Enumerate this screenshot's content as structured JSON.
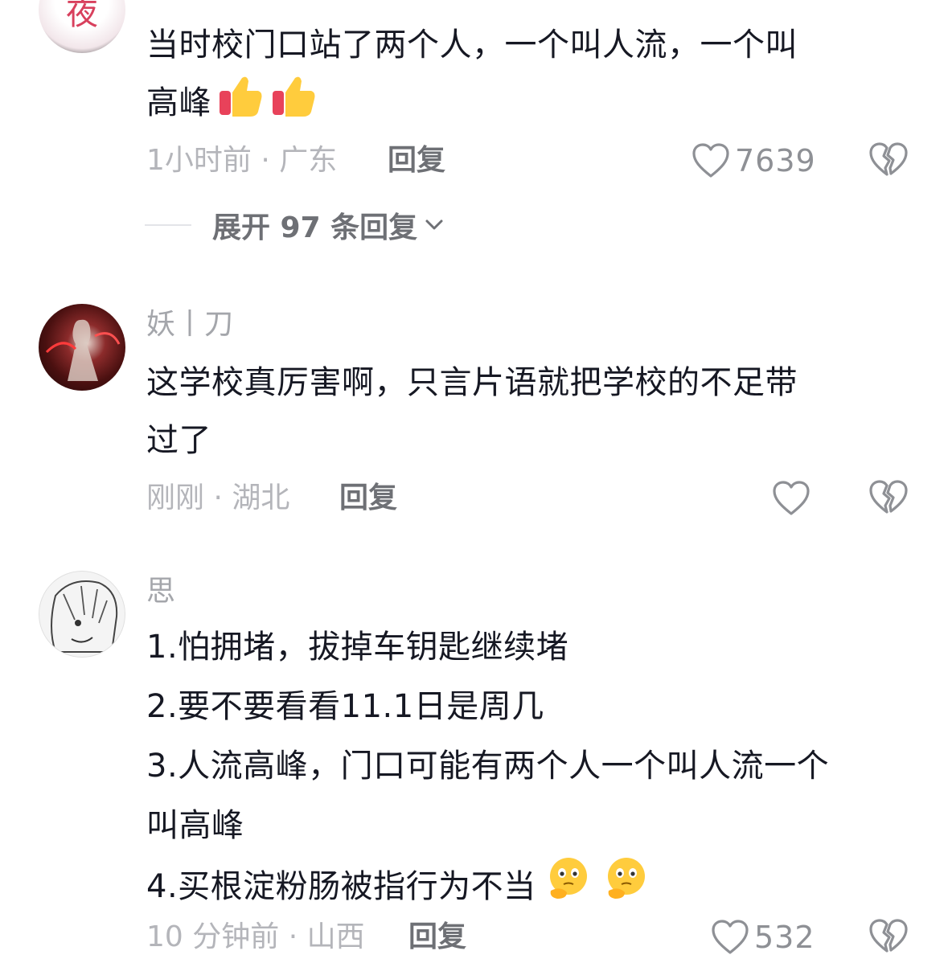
{
  "comments": [
    {
      "username": "",
      "lines": [
        "当时校门口站了两个人，一个叫人流，一个叫",
        "高峰"
      ],
      "time_location": "1小时前 · 广东",
      "reply_label": "回复",
      "like_count": "7639",
      "emojis": [
        "thumbs-up-emoji",
        "thumbs-up-emoji"
      ]
    },
    {
      "username": "妖丨刀",
      "lines": [
        "这学校真厉害啊，只言片语就把学校的不足带",
        "过了"
      ],
      "time_location": "刚刚 · 湖北",
      "reply_label": "回复",
      "like_count": ""
    },
    {
      "username": "思",
      "lines": [
        "1.怕拥堵，拔掉车钥匙继续堵",
        "2.要不要看看11.1日是周几",
        "3.人流高峰，门口可能有两个人一个叫人流一个",
        "叫高峰",
        "4.买根淀粉肠被指行为不当"
      ],
      "time_location": "10 分钟前 · 山西",
      "reply_label": "回复",
      "like_count": "532",
      "emojis": [
        "thinking-face-emoji",
        "thinking-face-emoji"
      ]
    }
  ],
  "expand": {
    "label": "展开 97 条回复"
  },
  "colors": {
    "text_primary": "#161823",
    "text_muted": "#b4b5ba",
    "reply": "#6e7075",
    "icon": "#8e9095"
  }
}
